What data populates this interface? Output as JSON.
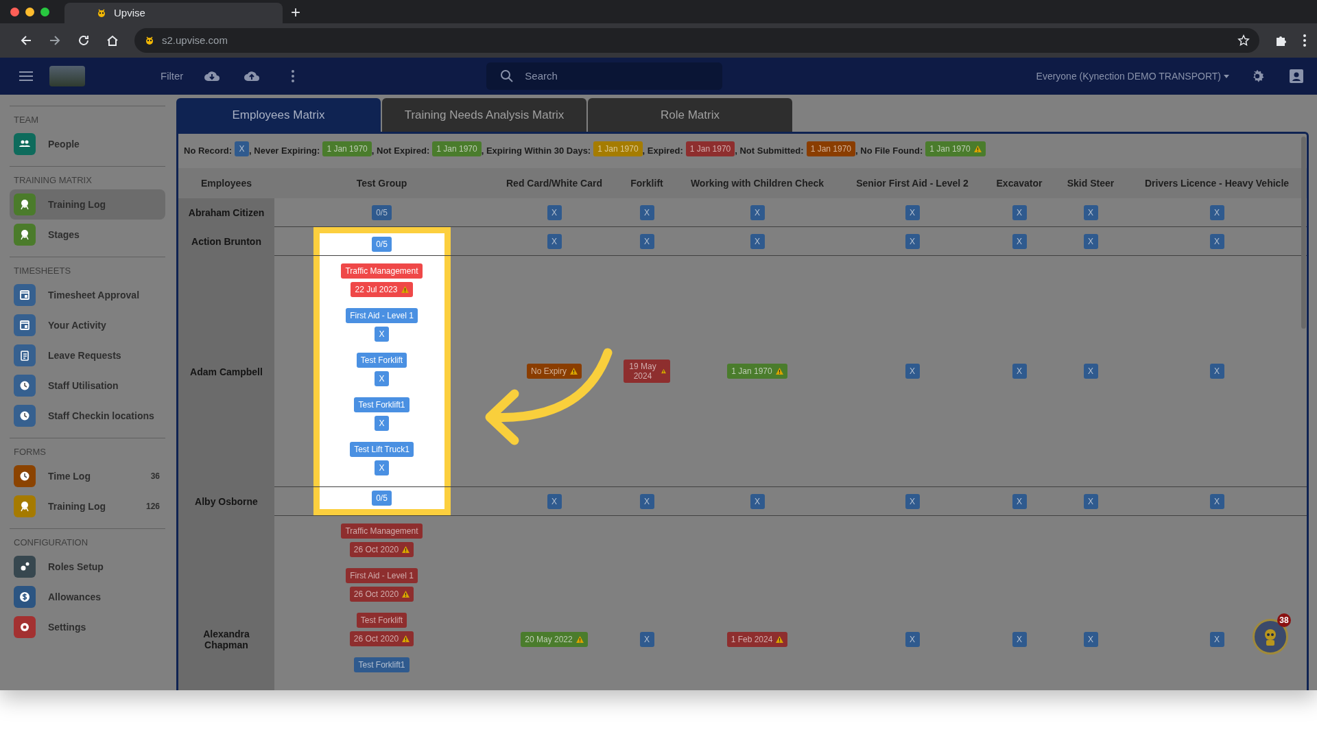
{
  "browser": {
    "tab_title": "Upvise",
    "new_tab": "+",
    "url": "s2.upvise.com"
  },
  "header": {
    "filter": "Filter",
    "search_placeholder": "Search",
    "account": "Everyone (Kynection DEMO TRANSPORT)"
  },
  "sidebar": [
    {
      "heading": "TEAM",
      "items": [
        {
          "label": "People",
          "kind": "people",
          "color": "#0e6b5c",
          "selected": false
        }
      ]
    },
    {
      "heading": "TRAINING MATRIX",
      "items": [
        {
          "label": "Training Log",
          "kind": "award",
          "color": "#4b7b2b",
          "selected": true
        },
        {
          "label": "Stages",
          "kind": "award",
          "color": "#4b7b2b",
          "selected": false
        }
      ]
    },
    {
      "heading": "TIMESHEETS",
      "items": [
        {
          "label": "Timesheet Approval",
          "kind": "calendar",
          "color": "#36608f",
          "selected": false
        },
        {
          "label": "Your Activity",
          "kind": "calendar",
          "color": "#36608f",
          "selected": false
        },
        {
          "label": "Leave Requests",
          "kind": "clipboard",
          "color": "#36608f",
          "selected": false
        },
        {
          "label": "Staff Utilisation",
          "kind": "clock",
          "color": "#36608f",
          "selected": false
        },
        {
          "label": "Staff Checkin locations",
          "kind": "clock",
          "color": "#36608f",
          "selected": false
        }
      ]
    },
    {
      "heading": "FORMS",
      "items": [
        {
          "label": "Time Log",
          "kind": "clock",
          "color": "#8b4300",
          "selected": false,
          "count": "36"
        },
        {
          "label": "Training Log",
          "kind": "award",
          "color": "#a57a00",
          "selected": false,
          "count": "126"
        }
      ]
    },
    {
      "heading": "CONFIGURATION",
      "items": [
        {
          "label": "Roles Setup",
          "kind": "gears",
          "color": "#37474f",
          "selected": false
        },
        {
          "label": "Allowances",
          "kind": "dollar",
          "color": "#2c5582",
          "selected": false
        },
        {
          "label": "Settings",
          "kind": "gear",
          "color": "#a33131",
          "selected": false
        }
      ]
    }
  ],
  "tabs": [
    {
      "label": "Employees Matrix",
      "selected": true
    },
    {
      "label": "Training Needs Analysis Matrix",
      "selected": false
    },
    {
      "label": "Role Matrix",
      "selected": false
    }
  ],
  "legend": [
    {
      "label": "No Record:",
      "badge": "X",
      "kind": "no_record"
    },
    {
      "label": ", Never Expiring:",
      "badge": "1 Jan 1970",
      "kind": "never_expiring"
    },
    {
      "label": ", Not Expired:",
      "badge": "1 Jan 1970",
      "kind": "not_expired"
    },
    {
      "label": ", Expiring Within 30 Days:",
      "badge": "1 Jan 1970",
      "kind": "expiring"
    },
    {
      "label": ", Expired:",
      "badge": "1 Jan 1970",
      "kind": "expired"
    },
    {
      "label": ", Not Submitted:",
      "badge": "1 Jan 1970",
      "kind": "not_submitted"
    },
    {
      "label": ", No File Found:",
      "badge": "1 Jan 1970",
      "kind": "no_file",
      "warning": true
    }
  ],
  "columns": [
    "Employees",
    "Test Group",
    "Red Card/White Card",
    "Forklift",
    "Working with Children Check",
    "Senior First Aid - Level 2",
    "Excavator",
    "Skid Steer",
    "Drivers Licence - Heavy Vehicle"
  ],
  "rows": [
    {
      "name": "Abraham Citizen",
      "test_group": {
        "summary": "0/5"
      },
      "cells": [
        {
          "value": "X",
          "kind": "no_record"
        },
        {
          "value": "X",
          "kind": "no_record"
        },
        {
          "value": "X",
          "kind": "no_record"
        },
        {
          "value": "X",
          "kind": "no_record"
        },
        {
          "value": "X",
          "kind": "no_record"
        },
        {
          "value": "X",
          "kind": "no_record"
        },
        {
          "value": "X",
          "kind": "no_record"
        }
      ]
    },
    {
      "name": "Action Brunton",
      "spotlight": true,
      "test_group": {
        "summary": "0/5"
      },
      "cells": [
        {
          "value": "X",
          "kind": "no_record"
        },
        {
          "value": "X",
          "kind": "no_record"
        },
        {
          "value": "X",
          "kind": "no_record"
        },
        {
          "value": "X",
          "kind": "no_record"
        },
        {
          "value": "X",
          "kind": "no_record"
        },
        {
          "value": "X",
          "kind": "no_record"
        },
        {
          "value": "X",
          "kind": "no_record"
        }
      ]
    },
    {
      "name": "Adam Campbell",
      "spotlight": true,
      "test_group": {
        "items": [
          {
            "course": "Traffic Management",
            "value": "22 Jul 2023",
            "kind": "expired",
            "warning": true
          },
          {
            "course": "First Aid - Level 1",
            "value": "X",
            "kind": "no_record"
          },
          {
            "course": "Test Forklift",
            "value": "X",
            "kind": "no_record"
          },
          {
            "course": "Test Forklift1",
            "value": "X",
            "kind": "no_record"
          },
          {
            "course": "Test Lift Truck1",
            "value": "X",
            "kind": "no_record"
          }
        ]
      },
      "cells": [
        {
          "value": "No Expiry",
          "kind": "not_submitted",
          "warning": true
        },
        {
          "value": "19 May 2024",
          "kind": "expired",
          "warning": true
        },
        {
          "value": "1 Jan 1970",
          "kind": "not_expired",
          "warning": true
        },
        {
          "value": "X",
          "kind": "no_record"
        },
        {
          "value": "X",
          "kind": "no_record"
        },
        {
          "value": "X",
          "kind": "no_record"
        },
        {
          "value": "X",
          "kind": "no_record"
        }
      ]
    },
    {
      "name": "Alby Osborne",
      "spotlight": true,
      "test_group": {
        "summary": "0/5"
      },
      "cells": [
        {
          "value": "X",
          "kind": "no_record"
        },
        {
          "value": "X",
          "kind": "no_record"
        },
        {
          "value": "X",
          "kind": "no_record"
        },
        {
          "value": "X",
          "kind": "no_record"
        },
        {
          "value": "X",
          "kind": "no_record"
        },
        {
          "value": "X",
          "kind": "no_record"
        },
        {
          "value": "X",
          "kind": "no_record"
        }
      ]
    },
    {
      "name": "Alexandra Chapman",
      "test_group": {
        "items": [
          {
            "course": "Traffic Management",
            "value": "26 Oct 2020",
            "kind": "expired",
            "warning": true
          },
          {
            "course": "First Aid - Level 1",
            "value": "26 Oct 2020",
            "kind": "expired",
            "warning": true
          },
          {
            "course": "Test Forklift",
            "value": "26 Oct 2020",
            "kind": "expired",
            "warning": true
          },
          {
            "course": "Test Forklift1",
            "kind": "no_record"
          }
        ]
      },
      "cells": [
        {
          "value": "20 May 2022",
          "kind": "not_expired",
          "warning": true
        },
        {
          "value": "X",
          "kind": "no_record"
        },
        {
          "value": "1 Feb 2024",
          "kind": "expired",
          "warning": true
        },
        {
          "value": "X",
          "kind": "no_record"
        },
        {
          "value": "X",
          "kind": "no_record"
        },
        {
          "value": "X",
          "kind": "no_record"
        },
        {
          "value": "X",
          "kind": "no_record"
        }
      ]
    }
  ],
  "assistant": {
    "badge": "38"
  }
}
